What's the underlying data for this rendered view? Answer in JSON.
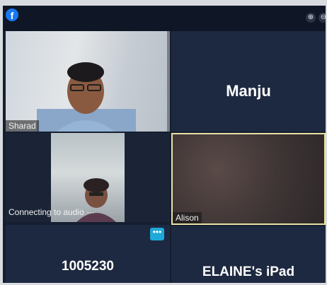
{
  "app": {
    "brand_icon": "facebook-icon",
    "brand_letter": "f"
  },
  "controls": {
    "zoom_in": "⊕",
    "zoom_out": "⊖"
  },
  "participants": [
    {
      "name": "Sharad",
      "type": "video"
    },
    {
      "name": "Manju",
      "type": "name-only"
    },
    {
      "name": "",
      "status": "Connecting to audio ···",
      "type": "video"
    },
    {
      "name": "Alison",
      "type": "video",
      "active_speaker": true
    },
    {
      "name": "1005230",
      "type": "name-only"
    },
    {
      "name": "ELAINE's iPad",
      "type": "name-only"
    }
  ],
  "more_button": {
    "label": "•••"
  },
  "colors": {
    "accent": "#1fa9d8",
    "highlight": "#e8e2a4",
    "tile": "#1d2940"
  }
}
